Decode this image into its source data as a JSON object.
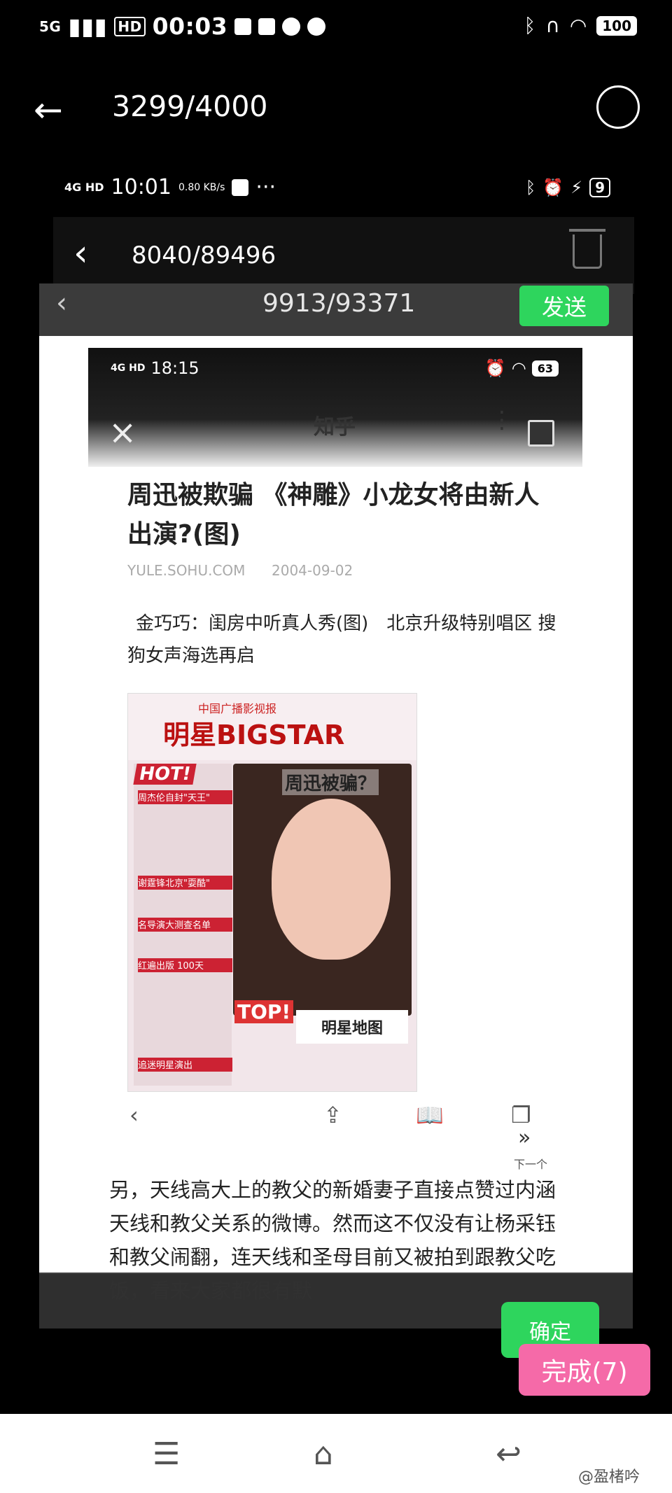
{
  "status_bar": {
    "network": "5G",
    "hd": "HD",
    "time": "00:03",
    "battery": "100"
  },
  "header": {
    "counter": "3299/4000"
  },
  "nested_shot_1": {
    "network": "4G HD",
    "time": "10:01",
    "speed": "0.80 KB/s",
    "dots": "···",
    "battery": "9",
    "counter": "8040/89496"
  },
  "nested_shot_2": {
    "counter": "9913/93371",
    "send_label": "发送"
  },
  "zhihu": {
    "network": "4G HD",
    "time": "18:15",
    "battery": "63",
    "app_title": "知乎",
    "article_title": "周迅被欺骗 《神雕》小龙女将由新人出演?(图)",
    "source": "YULE.SOHU.COM",
    "date": "2004-09-02",
    "related": "金巧巧：闺房中听真人秀(图)　北京升级特别唱区 搜狗女声海选再启",
    "next_label": "下一个"
  },
  "magazine": {
    "top_text": "中国广播影视报",
    "logo": "明星BIGSTAR",
    "hot": "HOT!",
    "headline": "周迅被骗？",
    "top": "TOP!",
    "map_label": "明星地图",
    "strips": [
      "周杰伦自封\"天王\"",
      "谢霆锋北京\"耍酷\"",
      "名导演大测查名单",
      "红遍出版 100天",
      "追迷明星演出"
    ]
  },
  "body_text": "另，天线高大上的教父的新婚妻子直接点赞过内涵天线和教父关系的微博。然而这不仅没有让杨采钰和教父闹翻，连天线和圣母目前又被拍到跟教父吃饭，看来大家都很有默",
  "bottom": {
    "confirm_label": "确定",
    "done_label": "完成(7)",
    "watermark": "@盈楮吟"
  }
}
